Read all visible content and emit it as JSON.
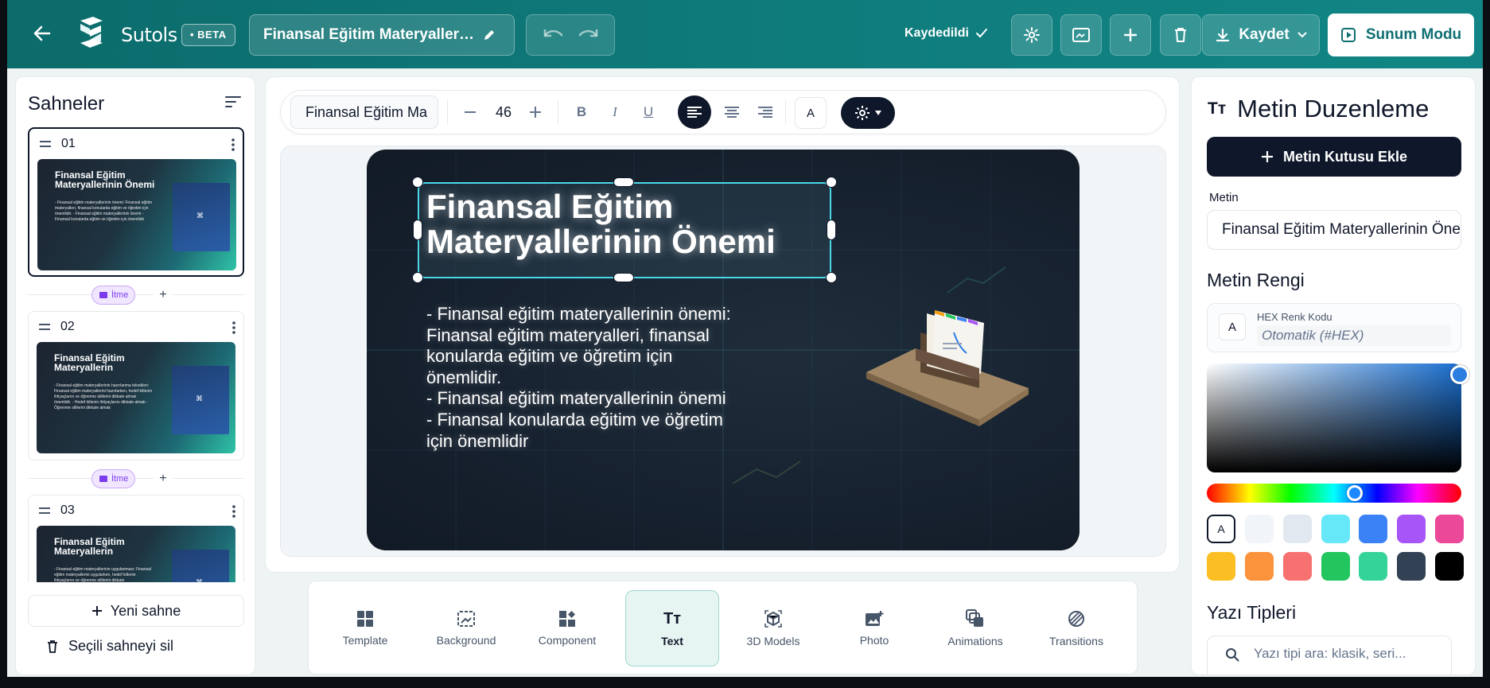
{
  "header": {
    "brand": "Sutols",
    "beta_badge": "• BETA",
    "presentation_title": "Finansal Eğitim Materyallerinin...",
    "save_status": "Kaydedildi",
    "save_label": "Kaydet",
    "present_label": "Sunum Modu"
  },
  "sidebar": {
    "title": "Sahneler",
    "scenes": [
      {
        "number": "01",
        "thumb_title": "Finansal Eğitim Materyallerinin Önemi",
        "thumb_body": "- Finansal eğitim materyallerinin önemi: Finansal eğitim materyalleri, finansal konularda eğitim ve öğretim için önemlidir. - Finansal eğitim materyallerinin önemi - Finansal konularda eğitim ve öğretim için önemlidir"
      },
      {
        "number": "02",
        "thumb_title": "Finansal Eğitim Materyallerin",
        "thumb_body": "- Finansal eğitim materyallerinin hazırlanma teknikleri: Finansal eğitim materyallerini hazırlarken, hedef kitlenin ihtiyaçlarını ve öğrenme stillerini dikkate almak önemlidir. - Hedef kitlenin ihtiyaçlarını dikkate almak - Öğrenme stillerini dikkate almak"
      },
      {
        "number": "03",
        "thumb_title": "Finansal Eğitim Materyallerin",
        "thumb_body": "- Finansal eğitim materyallerinin uygulanması: Finansal eğitim materyallerini uygularken, hedef kitlenin ihtiyaçlarını ve öğrenme stillerini dikkate"
      }
    ],
    "transition_label": "İtme",
    "new_scene": "Yeni sahne",
    "delete_scene": "Seçili sahneyi sil"
  },
  "toolbar": {
    "font_name": "Finansal Eğitim Ma",
    "font_size": "46",
    "color_button": "A"
  },
  "slide": {
    "title": "Finansal Eğitim Materyallerinin Önemi",
    "body": "- Finansal eğitim materyallerinin önemi:\nFinansal eğitim materyalleri, finansal\nkonularda eğitim ve öğretim için\nönemlidir.\n- Finansal eğitim materyallerinin önemi\n- Finansal konularda eğitim ve öğretim\niçin önemlidir"
  },
  "bottom_tools": [
    {
      "label": "Template",
      "icon": "template-icon"
    },
    {
      "label": "Background",
      "icon": "background-icon"
    },
    {
      "label": "Component",
      "icon": "component-icon"
    },
    {
      "label": "Text",
      "icon": "text-icon",
      "active": true
    },
    {
      "label": "3D Models",
      "icon": "cube-icon"
    },
    {
      "label": "Photo",
      "icon": "photo-icon"
    },
    {
      "label": "Animations",
      "icon": "animations-icon"
    },
    {
      "label": "Transitions",
      "icon": "transitions-icon"
    }
  ],
  "panel": {
    "title": "Metin Duzenleme",
    "add_text_button": "Metin Kutusu Ekle",
    "text_label": "Metin",
    "text_value": "Finansal Eğitim Materyallerinin Önemi",
    "color_section": "Metin Rengi",
    "hex_label": "HEX Renk Kodu",
    "hex_placeholder": "Otomatik (#HEX)",
    "swatch_auto": "A",
    "swatches": [
      "#f1f5f9",
      "#e2e8f0",
      "#67e8f9",
      "#3b82f6",
      "#a855f7",
      "#ec4899",
      "#fbbf24",
      "#fb923c",
      "#f87171",
      "#22c55e",
      "#34d399",
      "#334155",
      "#000000"
    ],
    "fonts_section": "Yazı Tipleri",
    "font_search_placeholder": "Yazı tipi ara: klasik, seri..."
  },
  "colors": {
    "header": "#0f7c7c",
    "dark": "#0f172a",
    "selection": "#4ad7e8",
    "accent_purple": "#7c3aed"
  }
}
